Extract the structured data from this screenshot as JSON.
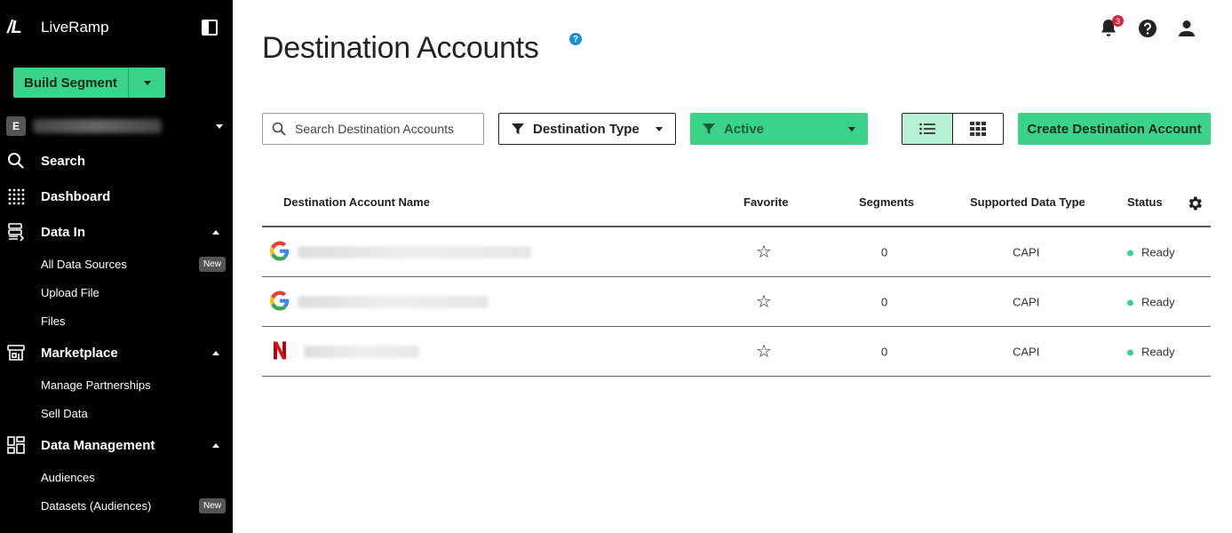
{
  "brand": {
    "logo": "/L",
    "name": "LiveRamp"
  },
  "sidebar": {
    "build_segment_label": "Build Segment",
    "org_badge": "E",
    "nav": [
      {
        "label": "Search",
        "icon": "search-icon"
      },
      {
        "label": "Dashboard",
        "icon": "dashboard-grid-icon"
      },
      {
        "label": "Data In",
        "icon": "data-in-icon",
        "sub": [
          "All Data Sources",
          "Upload File",
          "Files"
        ]
      },
      {
        "label": "Marketplace",
        "icon": "marketplace-icon",
        "sub": [
          "Manage Partnerships",
          "Sell Data"
        ]
      },
      {
        "label": "Data Management",
        "icon": "data-management-icon",
        "sub": [
          "Audiences",
          "Datasets (Audiences)"
        ]
      }
    ],
    "new_badge": "New"
  },
  "header": {
    "title": "Destination Accounts",
    "help": "?",
    "notification_count": "3"
  },
  "toolbar": {
    "search_placeholder": "Search Destination Accounts",
    "filter_type_label": "Destination Type",
    "filter_status_label": "Active",
    "create_label": "Create Destination Account"
  },
  "table": {
    "columns": [
      "Destination Account Name",
      "Favorite",
      "Segments",
      "Supported Data Type",
      "Status"
    ],
    "rows": [
      {
        "logo": "google-logo-icon",
        "segments": "0",
        "data_type": "CAPI",
        "status": "Ready"
      },
      {
        "logo": "google-logo-icon",
        "segments": "0",
        "data_type": "CAPI",
        "status": "Ready"
      },
      {
        "logo": "netflix-logo-icon",
        "segments": "0",
        "data_type": "CAPI",
        "status": "Ready"
      }
    ]
  },
  "colors": {
    "accent_green": "#3bd389",
    "sidebar_bg": "#000000",
    "status_ready": "#3bd389",
    "notification": "#d7263d",
    "help": "#1a90d9"
  }
}
